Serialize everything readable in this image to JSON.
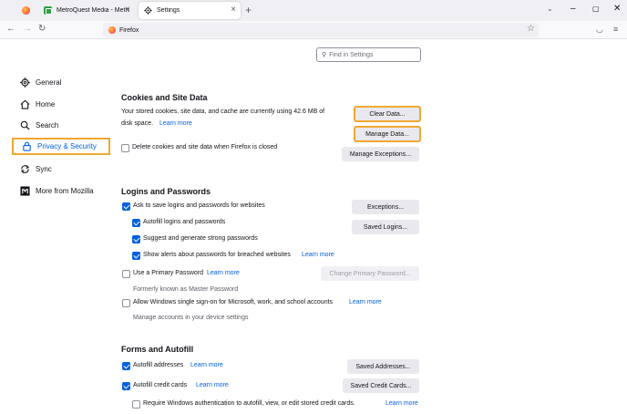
{
  "tabs": [
    {
      "title": "",
      "icon": "firefox-icon"
    },
    {
      "title": "MetroQuest Media - MetroQu",
      "icon": "metroquest-icon"
    },
    {
      "title": "Settings",
      "icon": "gear-icon"
    }
  ],
  "urlbar": {
    "identity": "Firefox"
  },
  "search": {
    "placeholder": "Find in Settings"
  },
  "sidebar": {
    "items": [
      {
        "label": "General",
        "icon": "gear-icon"
      },
      {
        "label": "Home",
        "icon": "home-icon"
      },
      {
        "label": "Search",
        "icon": "search-icon"
      },
      {
        "label": "Privacy & Security",
        "icon": "lock-icon",
        "selected": true
      },
      {
        "label": "Sync",
        "icon": "sync-icon"
      },
      {
        "label": "More from Mozilla",
        "icon": "mozilla-icon"
      }
    ]
  },
  "cookies": {
    "heading": "Cookies and Site Data",
    "desc_line1": "Your stored cookies, site data, and cache are currently using 42.6 MB of",
    "desc_line2": "disk space.",
    "learn_more": "Learn more",
    "clear_data": "Clear Data...",
    "manage_data": "Manage Data...",
    "manage_exceptions": "Manage Exceptions...",
    "delete_on_close": "Delete cookies and site data when Firefox is closed"
  },
  "logins": {
    "heading": "Logins and Passwords",
    "ask_to_save": "Ask to save logins and passwords for websites",
    "exceptions": "Exceptions...",
    "autofill": "Autofill logins and passwords",
    "saved_logins": "Saved Logins...",
    "suggest": "Suggest and generate strong passwords",
    "breach_alerts": "Show alerts about passwords for breached websites",
    "breach_learn_more": "Learn more",
    "primary_password": "Use a Primary Password",
    "primary_learn_more": "Learn more",
    "change_primary": "Change Primary Password...",
    "formerly": "Formerly known as Master Password",
    "windows_sso": "Allow Windows single sign-on for Microsoft, work, and school accounts",
    "sso_learn_more": "Learn more",
    "manage_accounts": "Manage accounts in your device settings"
  },
  "forms": {
    "heading": "Forms and Autofill",
    "autofill_addresses": "Autofill addresses",
    "addresses_learn_more": "Learn more",
    "saved_addresses": "Saved Addresses...",
    "autofill_cards": "Autofill credit cards",
    "cards_learn_more": "Learn more",
    "saved_cards": "Saved Credit Cards...",
    "require_windows_auth": "Require Windows authentication to autofill, view, or edit stored credit cards.",
    "auth_learn_more": "Learn more"
  },
  "colors": {
    "accent": "#0061e0",
    "highlight": "#f0a830"
  }
}
